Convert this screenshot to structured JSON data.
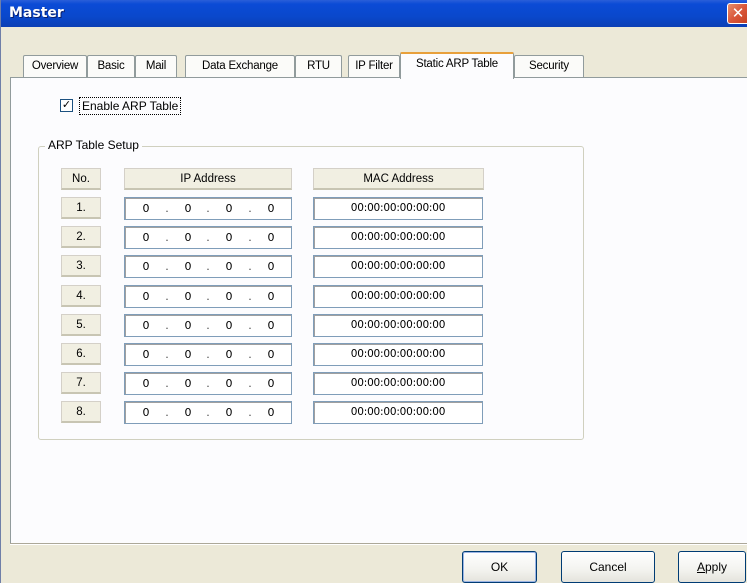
{
  "window": {
    "title": "Master",
    "close_symbol": "✕"
  },
  "tabs": [
    {
      "label": "Overview"
    },
    {
      "label": "Basic"
    },
    {
      "label": "Mail"
    },
    {
      "label": "Data Exchange"
    },
    {
      "label": "RTU"
    },
    {
      "label": "IP Filter"
    },
    {
      "label": "Static ARP Table",
      "active": true
    },
    {
      "label": "Security"
    }
  ],
  "enable_arp": {
    "checked": true,
    "check_mark": "✓",
    "label": "Enable ARP Table"
  },
  "arp_setup": {
    "group_title": "ARP Table Setup",
    "columns": {
      "no": "No.",
      "ip": "IP Address",
      "mac": "MAC Address"
    },
    "rows": [
      {
        "no": "1.",
        "ip": [
          "0",
          "0",
          "0",
          "0"
        ],
        "mac": "00:00:00:00:00:00"
      },
      {
        "no": "2.",
        "ip": [
          "0",
          "0",
          "0",
          "0"
        ],
        "mac": "00:00:00:00:00:00"
      },
      {
        "no": "3.",
        "ip": [
          "0",
          "0",
          "0",
          "0"
        ],
        "mac": "00:00:00:00:00:00"
      },
      {
        "no": "4.",
        "ip": [
          "0",
          "0",
          "0",
          "0"
        ],
        "mac": "00:00:00:00:00:00"
      },
      {
        "no": "5.",
        "ip": [
          "0",
          "0",
          "0",
          "0"
        ],
        "mac": "00:00:00:00:00:00"
      },
      {
        "no": "6.",
        "ip": [
          "0",
          "0",
          "0",
          "0"
        ],
        "mac": "00:00:00:00:00:00"
      },
      {
        "no": "7.",
        "ip": [
          "0",
          "0",
          "0",
          "0"
        ],
        "mac": "00:00:00:00:00:00"
      },
      {
        "no": "8.",
        "ip": [
          "0",
          "0",
          "0",
          "0"
        ],
        "mac": "00:00:00:00:00:00"
      }
    ],
    "ip_separator": "."
  },
  "buttons": {
    "ok": "OK",
    "cancel": "Cancel",
    "apply_first": "A",
    "apply_rest": "pply"
  }
}
